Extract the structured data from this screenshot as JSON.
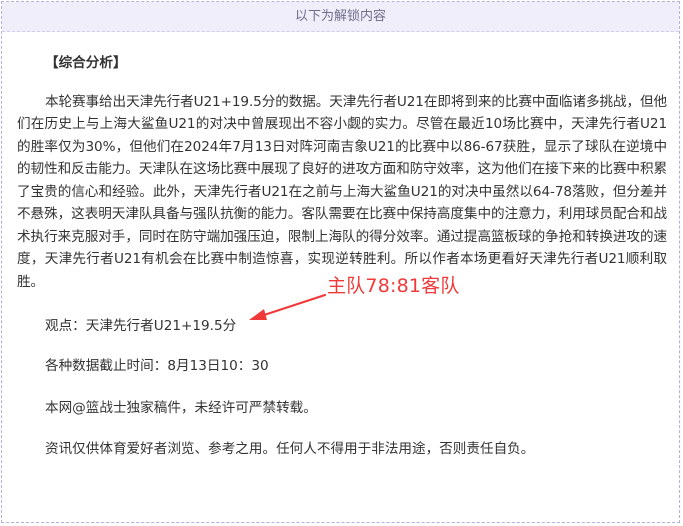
{
  "header": {
    "title": "以下为解锁内容"
  },
  "article": {
    "section_title": "【综合分析】",
    "paragraph": "本轮赛事给出天津先行者U21+19.5分的数据。天津先行者U21在即将到来的比赛中面临诸多挑战，但他们在历史上与上海大鲨鱼U21的对决中曾展现出不容小觑的实力。尽管在最近10场比赛中，天津先行者U21的胜率仅为30%，但他们在2024年7月13日对阵河南吉象U21的比赛中以86-67获胜，显示了球队在逆境中的韧性和反击能力。天津队在这场比赛中展现了良好的进攻方面和防守效率，这为他们在接下来的比赛中积累了宝贵的信心和经验。此外，天津先行者U21在之前与上海大鲨鱼U21的对决中虽然以64-78落败，但分差并不悬殊，这表明天津队具备与强队抗衡的能力。客队需要在比赛中保持高度集中的注意力，利用球员配合和战术执行来克服对手，同时在防守端加强压迫，限制上海队的得分效率。通过提高篮板球的争抢和转换进攻的速度，天津先行者U21有机会在比赛中制造惊喜，实现逆转胜利。所以作者本场更看好天津先行者U21顺利取胜。",
    "viewpoint": "观点：天津先行者U21+19.5分",
    "deadline": "各种数据截止时间：8月13日10：30",
    "copyright": "本网@篮战士独家稿件，未经许可严禁转载。",
    "disclaimer": "资讯仅供体育爱好者浏览、参考之用。任何人不得用于非法用途，否则责任自负。"
  },
  "annotation": {
    "text": "主队78:81客队",
    "color": "#f03a3a"
  },
  "colors": {
    "header_bg": "#f1eefb",
    "border": "#b7aee0",
    "text": "#333333"
  }
}
